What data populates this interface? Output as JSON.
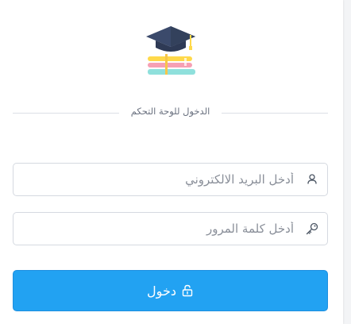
{
  "login": {
    "logo_icon": "graduation-cap-books-icon",
    "divider_text": "الدخول للوحة التحكم",
    "email": {
      "placeholder": "أدخل البريد الالكتروني",
      "value": "",
      "icon": "user-icon"
    },
    "password": {
      "placeholder": "أدخل كلمة المرور",
      "value": "",
      "icon": "key-icon"
    },
    "submit": {
      "label": "دخول",
      "icon": "unlock-icon"
    }
  },
  "colors": {
    "accent": "#22a2f2",
    "cap": "#33415c",
    "book_yellow": "#ffd94a",
    "book_pink": "#f6a0b4",
    "book_teal": "#8fe0dc"
  }
}
